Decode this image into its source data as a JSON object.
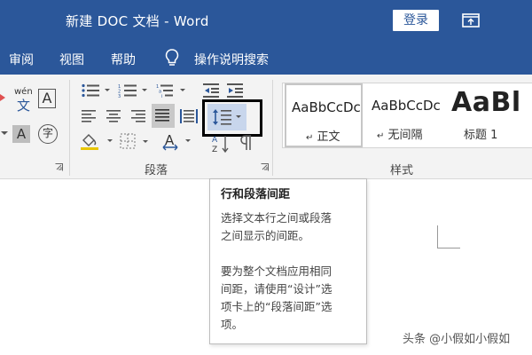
{
  "window": {
    "title": "新建 DOC 文档  -  Word",
    "login_label": "登录"
  },
  "menu": {
    "items": [
      "审阅",
      "视图",
      "帮助"
    ],
    "tell_me": "操作说明搜索"
  },
  "ribbon": {
    "paragraph_group_label": "段落",
    "styles_group_label": "样式",
    "char_small_label": "wén",
    "char_big_label": "文",
    "box_a_label": "A",
    "shaded_a_label": "A",
    "circle_char_label": "字",
    "styles": [
      {
        "sample": "AaBbCcDc",
        "name": "正文",
        "selected": true
      },
      {
        "sample": "AaBbCcDc",
        "name": "无间隔",
        "selected": false
      },
      {
        "sample": "AaBl",
        "name": "标题 1",
        "selected": false
      }
    ],
    "style_mark": "↵"
  },
  "tooltip": {
    "title": "行和段落间距",
    "paragraph1_lines": [
      "选择文本行之间或段落",
      "之间显示的间距。"
    ],
    "paragraph2_lines": [
      "要为整个文档应用相同",
      "间距，请使用“设计”选",
      "项卡上的“段落间距”选",
      "项。"
    ]
  },
  "watermark": "头条 @小假如小假如",
  "colors": {
    "titlebar": "#2b579a",
    "ribbon": "#f3f3f3",
    "icon_blue": "#2b579a",
    "highlight_outline": "#000000"
  }
}
